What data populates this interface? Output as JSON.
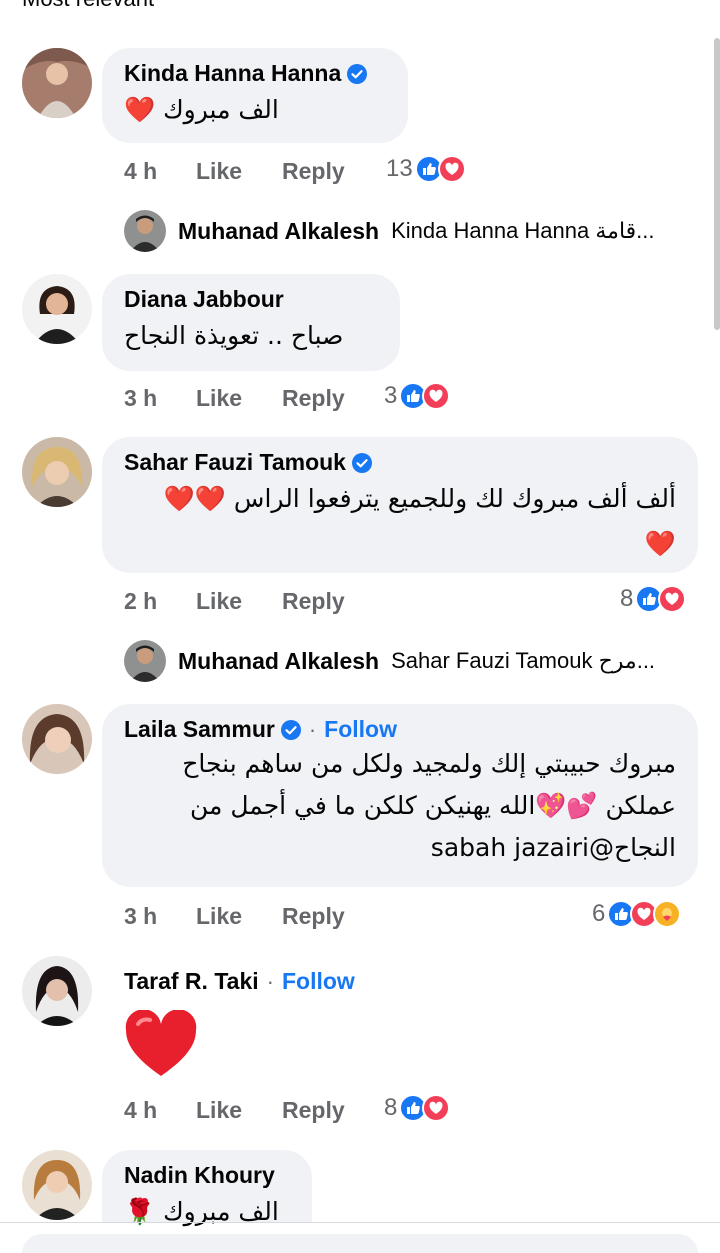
{
  "header": {
    "sort_label": "Most relevant"
  },
  "comments": [
    {
      "author": "Kinda Hanna Hanna",
      "verified": true,
      "text": "الف مبروك ❤️",
      "time": "4 h",
      "like": "Like",
      "reply": "Reply",
      "reaction_count": "13",
      "reactions": [
        "like",
        "love"
      ],
      "replies": [
        {
          "author": "Muhanad Alkalesh",
          "text": "Kinda Hanna Hanna قامة..."
        }
      ]
    },
    {
      "author": "Diana Jabbour",
      "verified": false,
      "text": "صباح .. تعويذة النجاح",
      "time": "3 h",
      "like": "Like",
      "reply": "Reply",
      "reaction_count": "3",
      "reactions": [
        "like",
        "love"
      ]
    },
    {
      "author": "Sahar Fauzi Tamouk",
      "verified": true,
      "text_line1": "ألف ألف مبروك لك وللجميع  يترفعوا الراس ❤️❤️",
      "text_line2": "❤️",
      "time": "2 h",
      "like": "Like",
      "reply": "Reply",
      "reaction_count": "8",
      "reactions": [
        "like",
        "love"
      ],
      "replies": [
        {
          "author": "Muhanad Alkalesh",
          "text": "Sahar Fauzi Tamouk مرح..."
        }
      ]
    },
    {
      "author": "Laila Sammur",
      "verified": true,
      "follow": "Follow",
      "text_line1": "مبروك حبيبتي إلك ولمجيد ولكل من ساهم بنجاح",
      "text_line2": "عملكن 💕💖الله يهنيكن كلكن ما في أجمل من",
      "text_line3": "النجاح@sabah jazairi",
      "time": "3 h",
      "like": "Like",
      "reply": "Reply",
      "reaction_count": "6",
      "reactions": [
        "like",
        "love",
        "care"
      ]
    },
    {
      "author": "Taraf R. Taki",
      "verified": false,
      "follow": "Follow",
      "text": "❤️",
      "time": "4 h",
      "like": "Like",
      "reply": "Reply",
      "reaction_count": "8",
      "reactions": [
        "like",
        "love"
      ]
    },
    {
      "author": "Nadin Khoury",
      "verified": false,
      "text": "الف مبروك 🌹"
    }
  ],
  "colors": {
    "link": "#1877f2",
    "meta": "#65676b",
    "bubble": "#f0f2f5",
    "like": "#1877f2",
    "love": "#f33e58",
    "care": "#f7b125"
  }
}
